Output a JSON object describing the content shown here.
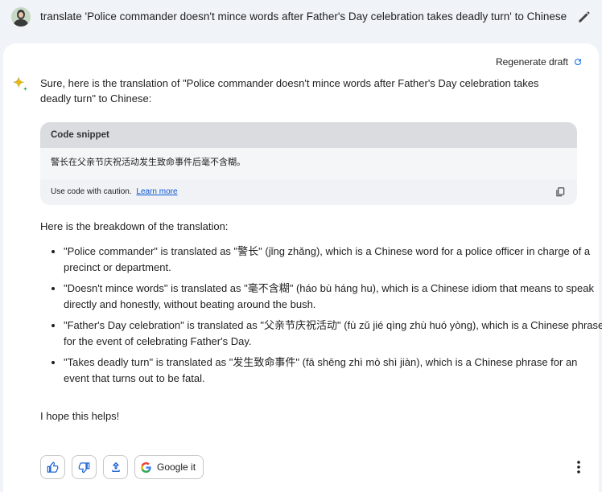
{
  "query": {
    "text": "translate 'Police commander doesn't mince words after Father's Day celebration takes deadly turn' to Chinese"
  },
  "response": {
    "regenerate_label": "Regenerate draft",
    "intro": "Sure, here is the translation of \"Police commander doesn't mince words after Father's Day celebration takes deadly turn\" to Chinese:",
    "code_snippet": {
      "header": "Code snippet",
      "content": "警长在父亲节庆祝活动发生致命事件后毫不含糊。",
      "caution": "Use code with caution.",
      "learn_more": "Learn more"
    },
    "breakdown_heading": "Here is the breakdown of the translation:",
    "points": [
      "\"Police commander\" is translated as \"警长\" (jǐng zhǎng), which is a Chinese word for a police officer in charge of a precinct or department.",
      "\"Doesn't mince words\" is translated as \"毫不含糊\" (háo bù háng hu), which is a Chinese idiom that means to speak directly and honestly, without beating around the bush.",
      "\"Father's Day celebration\" is translated as \"父亲节庆祝活动\" (fù zǔ jié qìng zhù huó yòng), which is a Chinese phrase for the event of celebrating Father's Day.",
      "\"Takes deadly turn\" is translated as \"发生致命事件\" (fā shēng zhì mò shì jiàn), which is a Chinese phrase for an event that turns out to be fatal."
    ],
    "closing": "I hope this helps!"
  },
  "actions": {
    "google_label": "Google it"
  },
  "colors": {
    "accent": "#1a73e8",
    "background": "#f0f4f9"
  }
}
